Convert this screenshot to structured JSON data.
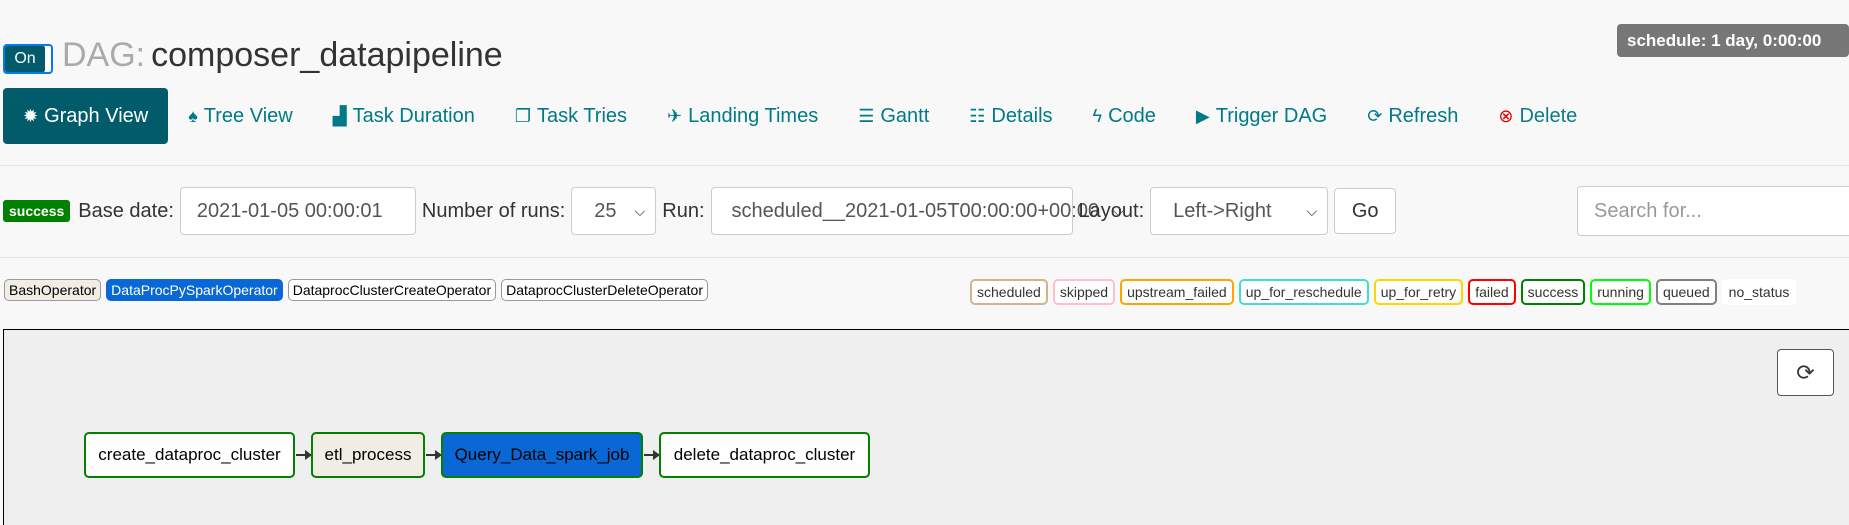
{
  "header": {
    "toggle_label": "On",
    "dag_prefix": "DAG:",
    "dag_name": "composer_datapipeline",
    "schedule": "schedule: 1 day, 0:00:00"
  },
  "nav": {
    "tabs": [
      {
        "label": "Graph View",
        "icon": "sun-icon",
        "glyph": "✹"
      },
      {
        "label": "Tree View",
        "icon": "tree-icon",
        "glyph": "♠"
      },
      {
        "label": "Task Duration",
        "icon": "bar-chart-icon",
        "glyph": "▟"
      },
      {
        "label": "Task Tries",
        "icon": "copy-icon",
        "glyph": "❐"
      },
      {
        "label": "Landing Times",
        "icon": "plane-icon",
        "glyph": "✈"
      },
      {
        "label": "Gantt",
        "icon": "align-left-icon",
        "glyph": "☰"
      },
      {
        "label": "Details",
        "icon": "list-icon",
        "glyph": "☷"
      },
      {
        "label": "Code",
        "icon": "flash-icon",
        "glyph": "ϟ"
      },
      {
        "label": "Trigger DAG",
        "icon": "play-circle-icon",
        "glyph": "▶"
      },
      {
        "label": "Refresh",
        "icon": "refresh-icon",
        "glyph": "⟳"
      },
      {
        "label": "Delete",
        "icon": "remove-circle-icon",
        "glyph": "⊗"
      }
    ]
  },
  "form": {
    "status_badge": "success",
    "base_date_label": "Base date:",
    "base_date_value": "2021-01-05 00:00:01",
    "num_runs_label": "Number of runs:",
    "num_runs_value": "25",
    "run_label": "Run:",
    "run_value": "scheduled__2021-01-05T00:00:00+00:00",
    "layout_label": "Layout:",
    "layout_value": "Left->Right",
    "go_label": "Go",
    "search_placeholder": "Search for..."
  },
  "operators": [
    {
      "label": "BashOperator",
      "color": "#f0ede4",
      "text": "#000000"
    },
    {
      "label": "DataProcPySparkOperator",
      "color": "#0a67d6",
      "text": "#ffffff"
    },
    {
      "label": "DataprocClusterCreateOperator",
      "color": "#ffffff",
      "text": "#000000"
    },
    {
      "label": "DataprocClusterDeleteOperator",
      "color": "#ffffff",
      "text": "#000000"
    }
  ],
  "states": [
    {
      "label": "scheduled",
      "color": "#d2b48c"
    },
    {
      "label": "skipped",
      "color": "#ffc0cb"
    },
    {
      "label": "upstream_failed",
      "color": "#ffa500"
    },
    {
      "label": "up_for_reschedule",
      "color": "#40e0d0"
    },
    {
      "label": "up_for_retry",
      "color": "#ffd700"
    },
    {
      "label": "failed",
      "color": "#ff0000"
    },
    {
      "label": "success",
      "color": "#008000"
    },
    {
      "label": "running",
      "color": "#00ff00"
    },
    {
      "label": "queued",
      "color": "#808080"
    },
    {
      "label": "no_status",
      "color": "#ffffff"
    }
  ],
  "graph": {
    "refresh_icon": "refresh-icon",
    "nodes": [
      {
        "label": "create_dataproc_cluster",
        "fill": "#ffffff",
        "text": "#000000"
      },
      {
        "label": "etl_process",
        "fill": "#f0ede4",
        "text": "#000000"
      },
      {
        "label": "Query_Data_spark_job",
        "fill": "#0a67d6",
        "text": "#000000"
      },
      {
        "label": "delete_dataproc_cluster",
        "fill": "#ffffff",
        "text": "#000000"
      }
    ]
  }
}
